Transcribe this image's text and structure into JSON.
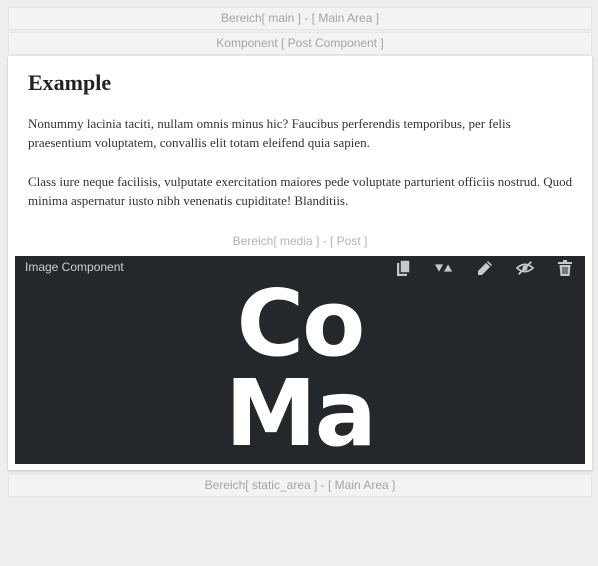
{
  "areas": {
    "main_label": "Bereich[ main ] - [ Main Area ]",
    "component_label": "Komponent [ Post Component ]",
    "static_label": "Bereich[ static_area ] - [ Main Area ]"
  },
  "post": {
    "title": "Example",
    "paragraphs": [
      "Nonummy lacinia taciti, nullam omnis minus hic? Faucibus perferendis temporibus, per felis praesentium voluptatem, convallis elit totam eleifend quia sapien.",
      "Class iure neque facilisis, vulputate exercitation maiores pede voluptate parturient officiis nostrud. Quod minima aspernatur iusto nibh venenatis cupiditate! Blanditiis."
    ],
    "media_label": "Bereich[ media ] - [ Post ]"
  },
  "image_component": {
    "title": "Image Component",
    "logo_line1": "Co",
    "logo_line2": "Ma",
    "tools": [
      "copy-icon",
      "move-icon",
      "edit-icon",
      "hide-icon",
      "delete-icon"
    ]
  },
  "colors": {
    "page_bg": "#eeeeee",
    "component_bg": "#24282b",
    "toolbar_icon": "#c8c8c8",
    "label_text": "#a4a4a4"
  }
}
